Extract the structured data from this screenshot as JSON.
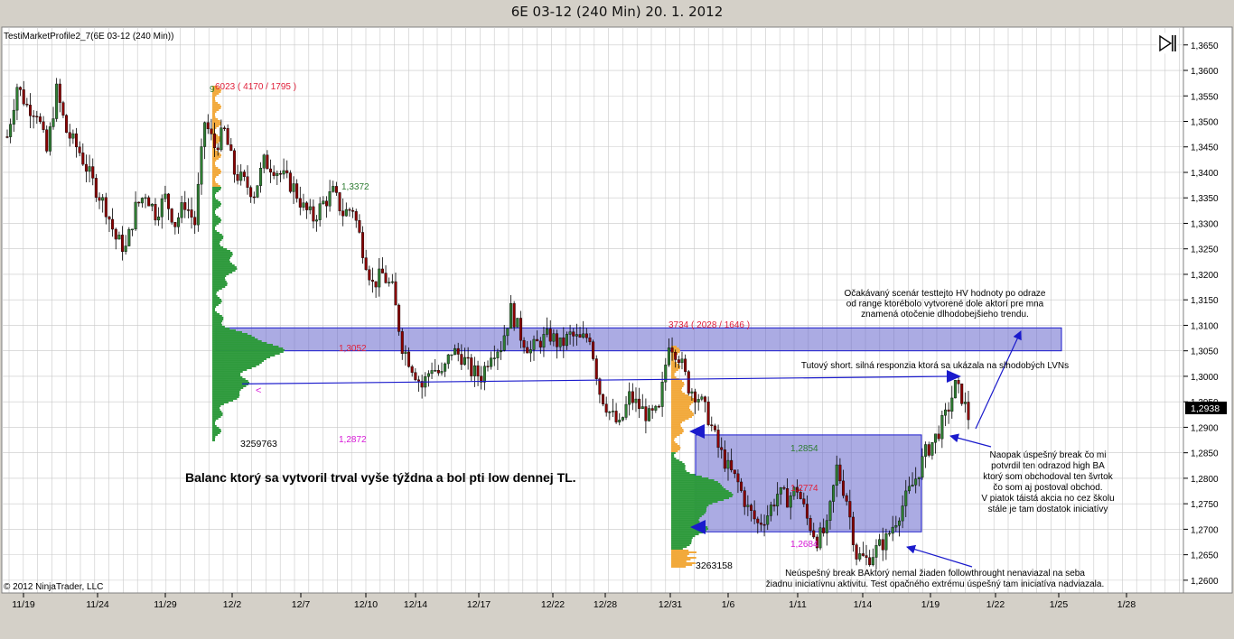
{
  "window": {
    "title": "6E 03-12 (240 Min)  20. 1. 2012"
  },
  "chart_header": {
    "indicator_label": "TestiMarketProfile2_7(6E 03-12 (240 Min))",
    "copyright": "© 2012 NinjaTrader, LLC",
    "nav_icon": "step-forward-icon"
  },
  "colors": {
    "chart_bg": "#ffffff",
    "grid": "#c8c8c8",
    "up_candle": "#2e7d32",
    "down_candle": "#8b0000",
    "profile_green": "#2e9a3c",
    "profile_orange": "#f2a93b",
    "zone_fill": "#6666cc",
    "zone_stroke": "#1a1acc",
    "arrow": "#1a1acc",
    "red_label": "#e0203a",
    "magenta_label": "#d81ad8",
    "green_label": "#2e7d32",
    "price_badge": "#000000"
  },
  "chart_data": {
    "type": "candlestick",
    "symbol": "6E 03-12",
    "timeframe": "240 Min",
    "ylim": [
      1.2575,
      1.3685
    ],
    "y_ticks": [
      "1,3650",
      "1,3600",
      "1,3550",
      "1,3500",
      "1,3450",
      "1,3400",
      "1,3350",
      "1,3300",
      "1,3250",
      "1,3200",
      "1,3150",
      "1,3100",
      "1,3050",
      "1,3000",
      "1,2950",
      "1,2900",
      "1,2850",
      "1,2800",
      "1,2750",
      "1,2700",
      "1,2650",
      "1,2600"
    ],
    "x_ticks": [
      "11/19",
      "11/24",
      "11/29",
      "12/2",
      "12/7",
      "12/10",
      "12/14",
      "12/17",
      "12/22",
      "12/28",
      "12/31",
      "1/6",
      "1/11",
      "1/14",
      "1/19",
      "1/22",
      "1/25",
      "1/28"
    ],
    "last_price": "1,2938",
    "price_path": [
      [
        0,
        1.347
      ],
      [
        3,
        1.357
      ],
      [
        6,
        1.353
      ],
      [
        9,
        1.352
      ],
      [
        12,
        1.344
      ],
      [
        15,
        1.356
      ],
      [
        18,
        1.348
      ],
      [
        22,
        1.344
      ],
      [
        26,
        1.338
      ],
      [
        30,
        1.333
      ],
      [
        33,
        1.327
      ],
      [
        36,
        1.325
      ],
      [
        39,
        1.333
      ],
      [
        42,
        1.336
      ],
      [
        45,
        1.332
      ],
      [
        48,
        1.335
      ],
      [
        51,
        1.33
      ],
      [
        54,
        1.334
      ],
      [
        57,
        1.33
      ],
      [
        60,
        1.35
      ],
      [
        63,
        1.345
      ],
      [
        66,
        1.348
      ],
      [
        69,
        1.34
      ],
      [
        72,
        1.338
      ],
      [
        75,
        1.336
      ],
      [
        78,
        1.342
      ],
      [
        81,
        1.341
      ],
      [
        84,
        1.339
      ],
      [
        87,
        1.337
      ],
      [
        90,
        1.333
      ],
      [
        93,
        1.331
      ],
      [
        96,
        1.334
      ],
      [
        99,
        1.336
      ],
      [
        102,
        1.332
      ],
      [
        105,
        1.333
      ],
      [
        108,
        1.325
      ],
      [
        111,
        1.318
      ],
      [
        114,
        1.32
      ],
      [
        117,
        1.317
      ],
      [
        120,
        1.306
      ],
      [
        123,
        1.302
      ],
      [
        126,
        1.298
      ],
      [
        129,
        1.302
      ],
      [
        132,
        1.3
      ],
      [
        135,
        1.305
      ],
      [
        138,
        1.304
      ],
      [
        141,
        1.301
      ],
      [
        144,
        1.3
      ],
      [
        147,
        1.305
      ],
      [
        150,
        1.306
      ],
      [
        153,
        1.313
      ],
      [
        156,
        1.308
      ],
      [
        159,
        1.305
      ],
      [
        162,
        1.307
      ],
      [
        165,
        1.308
      ],
      [
        168,
        1.306
      ],
      [
        171,
        1.308
      ],
      [
        174,
        1.307
      ],
      [
        177,
        1.308
      ],
      [
        180,
        1.297
      ],
      [
        183,
        1.293
      ],
      [
        186,
        1.29
      ],
      [
        189,
        1.296
      ],
      [
        192,
        1.294
      ],
      [
        195,
        1.292
      ],
      [
        198,
        1.293
      ],
      [
        201,
        1.307
      ],
      [
        204,
        1.304
      ],
      [
        207,
        1.298
      ],
      [
        210,
        1.296
      ],
      [
        213,
        1.292
      ],
      [
        216,
        1.286
      ],
      [
        219,
        1.282
      ],
      [
        222,
        1.279
      ],
      [
        225,
        1.274
      ],
      [
        228,
        1.271
      ],
      [
        231,
        1.273
      ],
      [
        234,
        1.277
      ],
      [
        237,
        1.276
      ],
      [
        240,
        1.278
      ],
      [
        243,
        1.272
      ],
      [
        246,
        1.268
      ],
      [
        249,
        1.27
      ],
      [
        252,
        1.282
      ],
      [
        255,
        1.276
      ],
      [
        258,
        1.265
      ],
      [
        261,
        1.264
      ],
      [
        264,
        1.266
      ],
      [
        267,
        1.268
      ],
      [
        270,
        1.272
      ],
      [
        273,
        1.276
      ],
      [
        276,
        1.28
      ],
      [
        279,
        1.285
      ],
      [
        282,
        1.288
      ],
      [
        285,
        1.292
      ],
      [
        288,
        1.298
      ],
      [
        290,
        1.296
      ],
      [
        292,
        1.292
      ]
    ],
    "profiles": [
      {
        "top_label": "6023 ( 4170 / 1795 )",
        "top_index_label": "9",
        "poc_label": "1,3052",
        "val_label": "1,2872",
        "vah_label": "1,3372",
        "volume_label": "3259763",
        "marker_glyph": "<"
      },
      {
        "top_label": "3734 ( 2028 / 1646 )",
        "poc_label": "1,2774",
        "vah_label": "1,2854",
        "val_label": "1,2684",
        "volume_label": "3263158"
      }
    ],
    "zones": [
      {
        "name": "upper-value-zone",
        "top": 1.3095,
        "bottom": 1.305
      },
      {
        "name": "lower-balance-zone",
        "top": 1.2885,
        "bottom": 1.2695
      }
    ]
  },
  "annotations": {
    "balance_note": "Balanc ktorý sa vytvoril trval vyše týždna a bol pti low dennej TL.",
    "expected_scenario": [
      "Očakávaný scenár testtejto HV hodnoty po odraze",
      "od range ktorébolo vytvorené dole aktorí pre mna",
      "znamená otočenie dlhodobejšieho trendu."
    ],
    "short_note": "Tutový short. silná responzia ktorá sa ukázala na slhodobých LVNs",
    "breakout_note": [
      "Naopak úspešný break čo mi",
      "potvrdil ten odrazod high BA",
      "ktorý som obchodoval ten švrtok",
      "čo som aj postoval obchod.",
      "V piatok táistá akcia no cez školu",
      "stále je tam dostatok iniciatívy"
    ],
    "failed_break_note": [
      "Neúspešný break BAktorý nemal žiaden followthrought nenaviazal na seba",
      "žiadnu iniciatívnu aktivitu. Test opačného extrému úspešný tam iniciatíva nadviazala."
    ]
  }
}
